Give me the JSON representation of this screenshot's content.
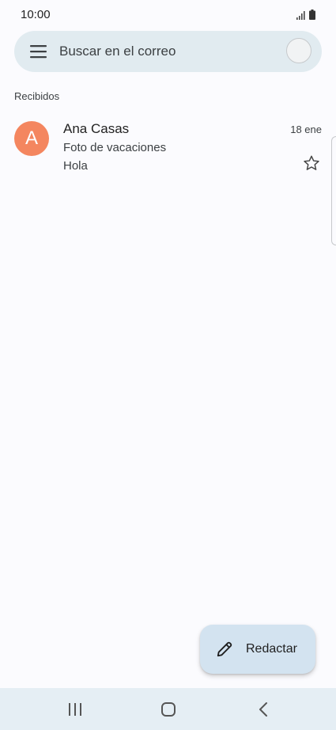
{
  "status_bar": {
    "time": "10:00",
    "icons": [
      "signal-icon",
      "battery-icon"
    ]
  },
  "search": {
    "placeholder": "Buscar en el correo",
    "menu_icon": "menu-icon",
    "account_icon": "account-avatar-icon"
  },
  "section": {
    "label": "Recibidos"
  },
  "emails": [
    {
      "avatar_letter": "A",
      "avatar_color": "#f4865f",
      "sender": "Ana Casas",
      "date": "18 ene",
      "subject": "Foto de vacaciones",
      "snippet": "Hola",
      "starred": false
    }
  ],
  "compose": {
    "label": "Redactar",
    "icon": "pencil-icon"
  },
  "nav": {
    "buttons": [
      "recent-apps-icon",
      "home-icon",
      "back-icon"
    ]
  },
  "colors": {
    "background": "#fbfbfe",
    "search_bg": "#e1ebf0",
    "fab_bg": "#d3e3f0",
    "nav_bg": "#e5eef4"
  }
}
